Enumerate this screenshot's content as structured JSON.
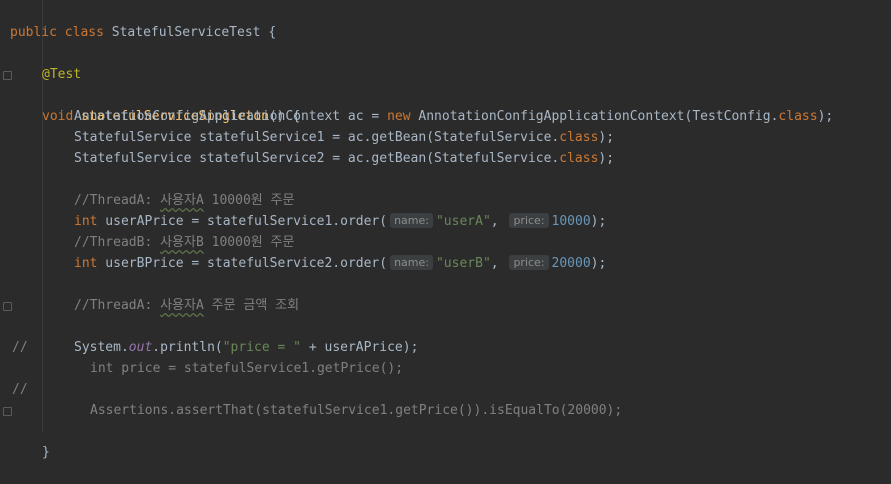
{
  "editor": {
    "lines": {
      "l1": {
        "kw1": "public",
        "kw2": "class",
        "name": "StatefulServiceTest",
        "brace": "{"
      },
      "l3": {
        "annotation": "@Test"
      },
      "l4": {
        "kw": "void",
        "method": "statefulServiceSingleton",
        "rest": "() {"
      },
      "l5": {
        "t1": "AnnotationConfigApplicationContext ac = ",
        "kw": "new",
        "t2": " AnnotationConfigApplicationContext(TestConfig.",
        "cls": "class",
        "t3": ");"
      },
      "l6": {
        "t1": "StatefulService statefulService1 = ac.getBean(StatefulService.",
        "cls": "class",
        "t2": ");"
      },
      "l7": {
        "t1": "StatefulService statefulService2 = ac.getBean(StatefulService.",
        "cls": "class",
        "t2": ");"
      },
      "l9": {
        "c1": "//ThreadA: ",
        "k": "사용자A",
        "c2": " 10000원 주문"
      },
      "l10": {
        "kw": "int",
        "t1": " userAPrice = statefulService1.order(",
        "hint1": "name:",
        "str": "\"userA\"",
        "comma": ", ",
        "hint2": "price:",
        "num": "10000",
        "end": ");"
      },
      "l11": {
        "c1": "//ThreadB: ",
        "k": "사용자B",
        "c2": " 10000원 주문"
      },
      "l12": {
        "kw": "int",
        "t1": " userBPrice = statefulService2.order(",
        "hint1": "name:",
        "str": "\"userB\"",
        "comma": ", ",
        "hint2": "price:",
        "num": "20000",
        "end": ");"
      },
      "l14": {
        "c1": "//ThreadA: ",
        "k": "사용자A",
        "c2": " 주문 금액 조회"
      },
      "l15": {
        "marker": "//",
        "code": "int price = statefulService1.getPrice();"
      },
      "l16": {
        "t1": "System.",
        "field": "out",
        "t2": ".println(",
        "str": "\"price = \"",
        "t3": " + userAPrice);"
      },
      "l18": {
        "marker": "//",
        "code": "Assertions.assertThat(statefulService1.getPrice()).isEqualTo(20000);"
      },
      "l20": {
        "brace": "}"
      }
    }
  }
}
